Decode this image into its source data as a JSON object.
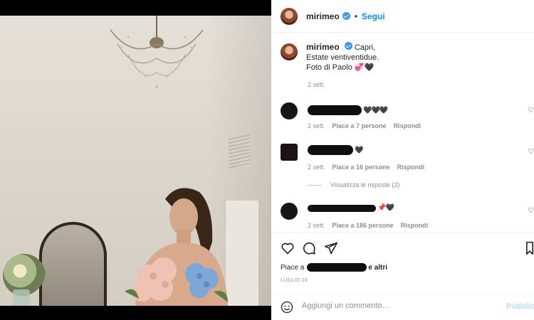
{
  "post": {
    "username": "mirimeo",
    "follow_label": "Segui",
    "dot": "•",
    "caption_lines": [
      "Capri,",
      "Estate ventiventidue.",
      "Foto di Paolo 💞🖤"
    ],
    "caption_time": "2 sett."
  },
  "comments": [
    {
      "text": "🖤🖤🖤",
      "time": "2 sett.",
      "likes": "Piace a 7 persone",
      "reply": "Rispondi"
    },
    {
      "text": "🖤",
      "time": "2 sett.",
      "likes": "Piace a 16 persone",
      "reply": "Rispondi"
    },
    {
      "text": "📌🖤",
      "time": "2 sett.",
      "likes": "Piace a 186 persone",
      "reply": "Rispondi"
    }
  ],
  "view_replies": "Visualizza le risposte (2)",
  "likes_prefix": "Piace a",
  "likes_suffix": "e altri",
  "date": "LUGLIO 23",
  "comment_box": {
    "placeholder": "Aggiungi un commento...",
    "publish": "Pubblica"
  },
  "icons": [
    "heart-icon",
    "comment-icon",
    "share-icon",
    "bookmark-icon",
    "emoji-icon",
    "verified-badge-icon"
  ],
  "colors": {
    "accent": "#0095f6",
    "muted": "#8e8e8e",
    "text": "#262626"
  }
}
